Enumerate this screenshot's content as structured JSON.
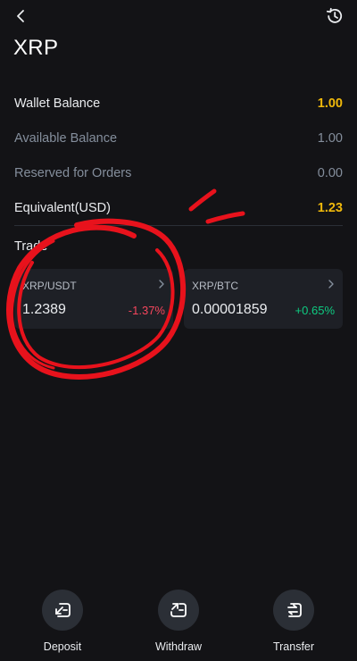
{
  "header": {
    "title": "XRP",
    "back_icon": "chevron-left-icon",
    "history_icon": "history-icon"
  },
  "balances": [
    {
      "label": "Wallet Balance",
      "value": "1.00",
      "emphasis": true
    },
    {
      "label": "Available Balance",
      "value": "1.00",
      "emphasis": false
    },
    {
      "label": "Reserved for Orders",
      "value": "0.00",
      "emphasis": false
    },
    {
      "label": "Equivalent(USD)",
      "value": "1.23",
      "emphasis": true
    }
  ],
  "trade": {
    "title": "Trade",
    "pairs": [
      {
        "pair": "XRP/USDT",
        "price": "1.2389",
        "change": "-1.37%",
        "direction": "down"
      },
      {
        "pair": "XRP/BTC",
        "price": "0.00001859",
        "change": "+0.65%",
        "direction": "up"
      }
    ]
  },
  "actions": [
    {
      "label": "Deposit",
      "icon": "deposit-icon"
    },
    {
      "label": "Withdraw",
      "icon": "withdraw-icon"
    },
    {
      "label": "Transfer",
      "icon": "transfer-icon"
    }
  ],
  "colors": {
    "background": "#131316",
    "accent": "#f0b90b",
    "down": "#f6465d",
    "up": "#0ecb81",
    "muted": "#848e9c",
    "card": "#1e2026",
    "annotation": "#e8121c"
  }
}
